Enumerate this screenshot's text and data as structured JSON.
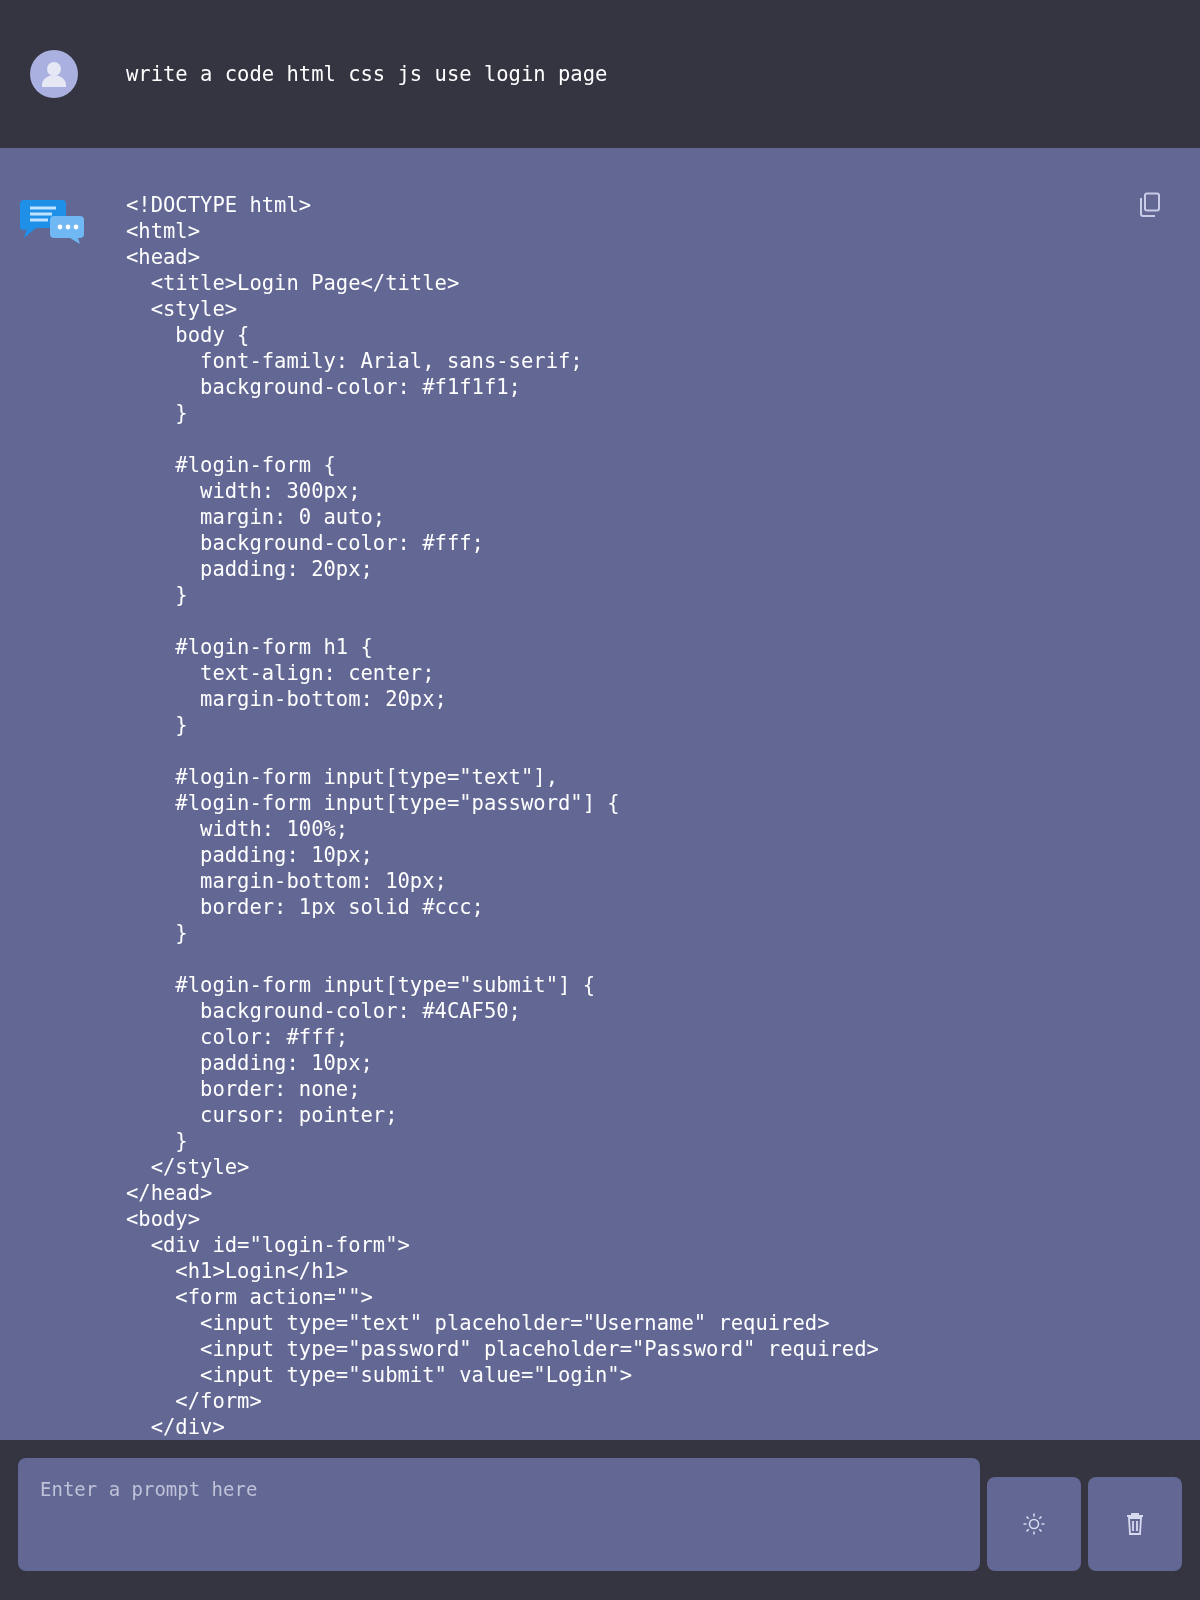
{
  "user_message": {
    "text": "write a code html css js use login page"
  },
  "bot_message": {
    "code_blocks": [
      [
        "<!DOCTYPE html>",
        "<html>",
        "<head>",
        "  <title>Login Page</title>",
        "  <style>",
        "    body {",
        "      font-family: Arial, sans-serif;",
        "      background-color: #f1f1f1;",
        "    }"
      ],
      [
        "    #login-form {",
        "      width: 300px;",
        "      margin: 0 auto;",
        "      background-color: #fff;",
        "      padding: 20px;",
        "    }"
      ],
      [
        "    #login-form h1 {",
        "      text-align: center;",
        "      margin-bottom: 20px;",
        "    }"
      ],
      [
        "    #login-form input[type=\"text\"],",
        "    #login-form input[type=\"password\"] {",
        "      width: 100%;",
        "      padding: 10px;",
        "      margin-bottom: 10px;",
        "      border: 1px solid #ccc;",
        "    }"
      ],
      [
        "    #login-form input[type=\"submit\"] {",
        "      background-color: #4CAF50;",
        "      color: #fff;",
        "      padding: 10px;",
        "      border: none;",
        "      cursor: pointer;",
        "    }",
        "  </style>",
        "</head>",
        "<body>",
        "  <div id=\"login-form\">",
        "    <h1>Login</h1>",
        "    <form action=\"\">",
        "      <input type=\"text\" placeholder=\"Username\" required>",
        "      <input type=\"password\" placeholder=\"Password\" required>",
        "      <input type=\"submit\" value=\"Login\">",
        "    </form>",
        "  </div>"
      ]
    ]
  },
  "prompt": {
    "placeholder": "Enter a prompt here"
  }
}
